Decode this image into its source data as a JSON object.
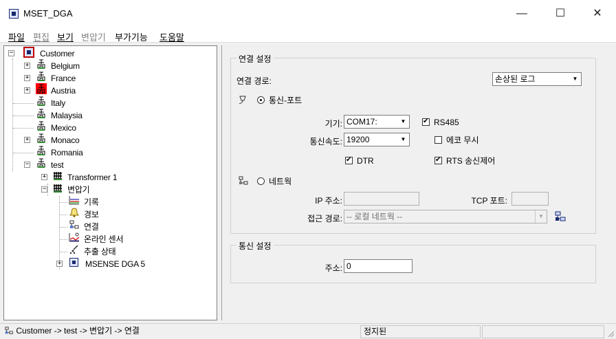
{
  "window": {
    "title": "MSET_DGA",
    "minimize_symbol": "—",
    "maximize_symbol": "☐",
    "close_symbol": "✕"
  },
  "menu": {
    "items": [
      {
        "label": "파일",
        "enabled": true
      },
      {
        "label": "편집",
        "enabled": false
      },
      {
        "label": "보기",
        "enabled": true
      },
      {
        "label": "변압기",
        "enabled": false
      },
      {
        "label": "부가기능",
        "enabled": true
      },
      {
        "label": "도움말",
        "enabled": true
      }
    ]
  },
  "tree": {
    "nodes": [
      {
        "label": "Customer",
        "icon": "customer-icon",
        "expander": "−"
      },
      {
        "label": "Belgium",
        "icon": "substation-icon",
        "expander": "+"
      },
      {
        "label": "France",
        "icon": "substation-icon",
        "expander": "+"
      },
      {
        "label": "Austria",
        "icon": "substation-alarm-icon",
        "expander": "+"
      },
      {
        "label": "Italy",
        "icon": "substation-icon",
        "expander": ""
      },
      {
        "label": "Malaysia",
        "icon": "substation-icon",
        "expander": ""
      },
      {
        "label": "Mexico",
        "icon": "substation-icon",
        "expander": ""
      },
      {
        "label": "Monaco",
        "icon": "substation-icon",
        "expander": "+"
      },
      {
        "label": "Romania",
        "icon": "substation-icon",
        "expander": ""
      },
      {
        "label": "test",
        "icon": "substation-icon",
        "expander": "−"
      },
      {
        "label": "Transformer 1",
        "icon": "transformer-icon",
        "expander": "+"
      },
      {
        "label": "변압기",
        "icon": "transformer-icon",
        "expander": "−"
      },
      {
        "label": "기록",
        "icon": "chart-record-icon",
        "expander": ""
      },
      {
        "label": "경보",
        "icon": "bell-icon",
        "expander": ""
      },
      {
        "label": "연결",
        "icon": "network-connection-icon",
        "expander": ""
      },
      {
        "label": "온라인 센서",
        "icon": "online-sensor-icon",
        "expander": ""
      },
      {
        "label": "추출 상태",
        "icon": "extraction-icon",
        "expander": ""
      },
      {
        "label": "MSENSE DGA 5",
        "icon": "device-icon",
        "expander": "+"
      }
    ]
  },
  "connection": {
    "group_title": "연결 설정",
    "path_label": "연결 경로:",
    "path_value": "손상된 로그",
    "comm_port_radio": "통신-포트",
    "comm_port_selected": true,
    "device_label": "기기:",
    "device_value": "COM17:",
    "rs485_label": "RS485",
    "rs485_checked": true,
    "baud_label": "통신속도:",
    "baud_value": "19200",
    "echo_label": "에코 무시",
    "echo_checked": false,
    "dtr_label": "DTR",
    "dtr_checked": true,
    "rts_label": "RTS 송신제어",
    "rts_checked": true,
    "network_radio": "네트웍",
    "network_selected": false,
    "ip_label": "IP 주소:",
    "ip_value": "",
    "tcp_label": "TCP 포트:",
    "tcp_value": "",
    "access_label": "접근 경로:",
    "access_value": "-- 로컬 네트웍 --"
  },
  "comm": {
    "group_title": "통신 설정",
    "address_label": "주소:",
    "address_value": "0"
  },
  "status": {
    "path": "Customer -> test -> 변압기 -> 연결",
    "state": "정지된",
    "extra": ""
  },
  "colors": {
    "alarm": "#ff0000",
    "tree_icon_blue": "#1a2a6c",
    "customer_icon_border": "#c00000"
  }
}
